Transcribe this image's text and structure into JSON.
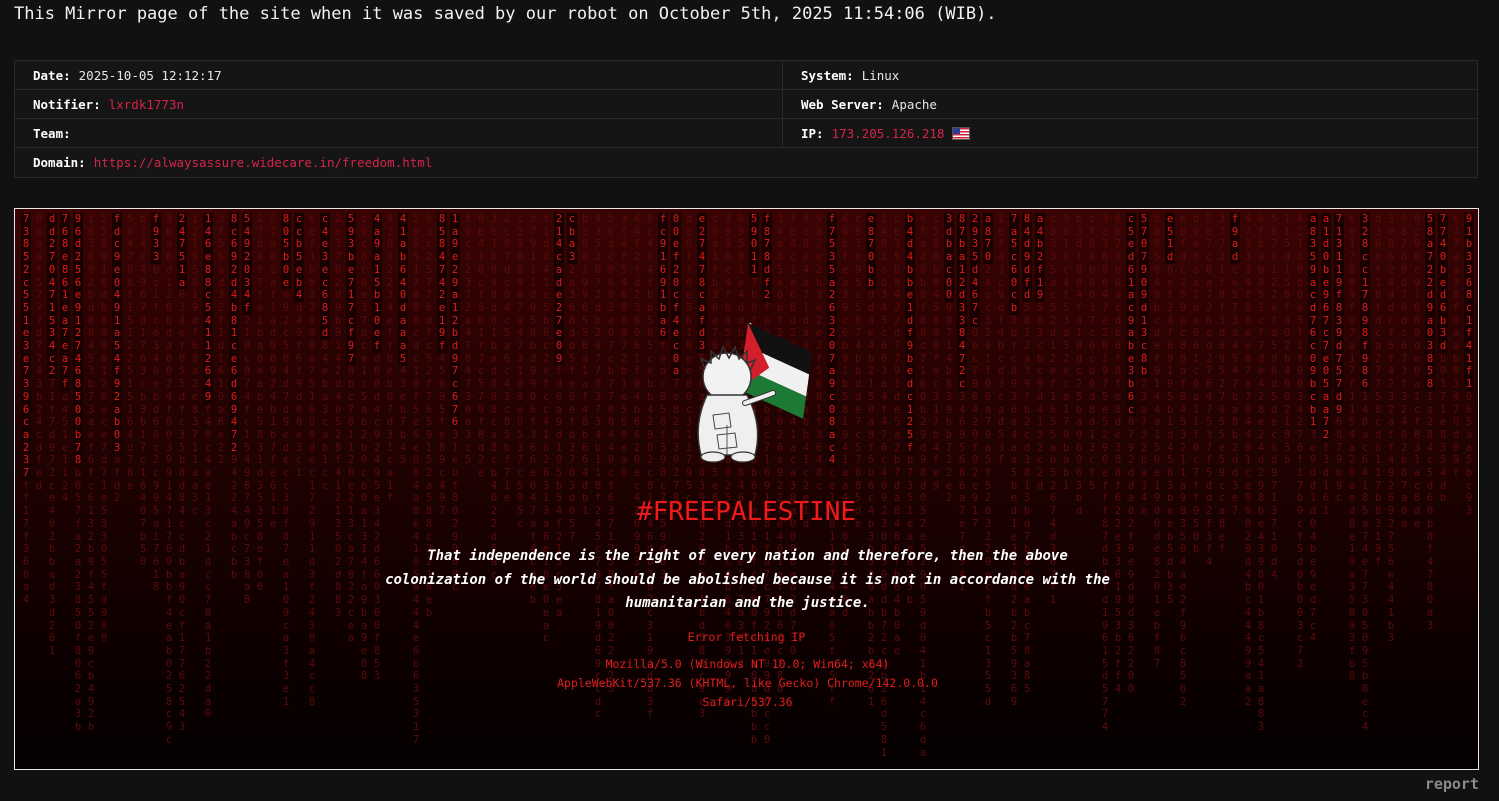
{
  "header": {
    "notice": "This Mirror page of the site when it was saved by our robot on October 5th, 2025 11:54:06 (WIB)."
  },
  "info": {
    "date": {
      "label": "Date:",
      "value": "2025-10-05 12:12:17"
    },
    "system": {
      "label": "System:",
      "value": "Linux"
    },
    "notifier": {
      "label": "Notifier:",
      "value": "lxrdk1773n"
    },
    "web_server": {
      "label": "Web Server:",
      "value": "Apache"
    },
    "team": {
      "label": "Team:",
      "value": ""
    },
    "ip": {
      "label": "IP:",
      "value": "173.205.126.218",
      "flag_icon": "us-flag-icon"
    },
    "domain": {
      "label": "Domain:",
      "value": "https://alwaysassure.widecare.in/freedom.html"
    }
  },
  "mirror": {
    "headline": "#FREEPALESTINE",
    "quote": "That independence is the right of every nation and therefore, then the above colonization of the world should be abolished because it is not in accordance with the humanitarian and the justice.",
    "ip_status": "Error fetching IP",
    "user_agent_lines": [
      "Mozilla/5.0 (Windows NT 10.0; Win64; x64)",
      "AppleWebKit/537.36 (KHTML, like Gecko) Chrome/142.0.0.0",
      "Safari/537.36"
    ],
    "figure_icon": "handala-with-palestine-flag-icon"
  },
  "footer": {
    "report_label": "report"
  },
  "colors": {
    "background": "#111111",
    "link": "#d4244a",
    "matrix_red": "#e01b1b",
    "headline_red": "#f01a1a"
  }
}
